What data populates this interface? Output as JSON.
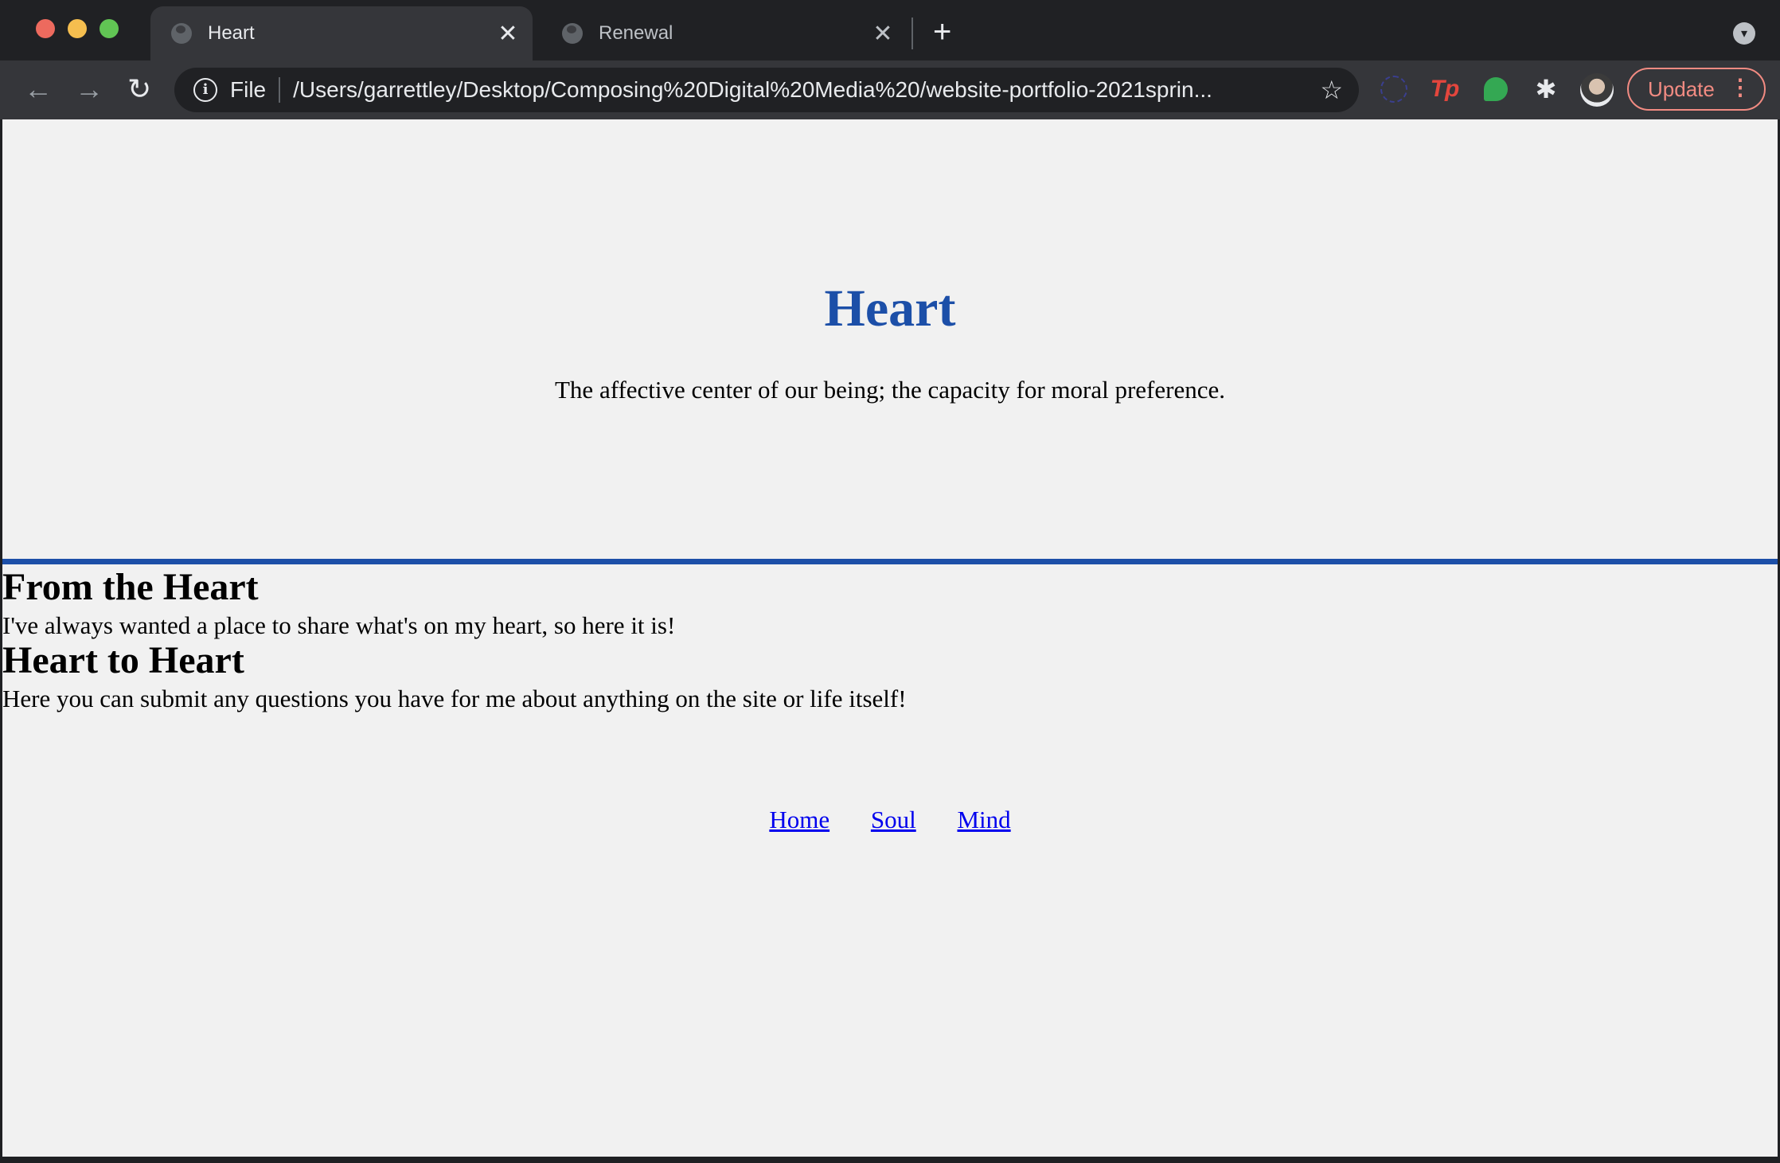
{
  "browser": {
    "tabs": [
      {
        "title": "Heart",
        "active": true
      },
      {
        "title": "Renewal",
        "active": false
      }
    ],
    "new_tab_symbol": "+",
    "close_symbol": "✕",
    "address": {
      "scheme_label": "File",
      "url": "/Users/garrettley/Desktop/Composing%20Digital%20Media%20/website-portfolio-2021sprin..."
    },
    "update_button": "Update",
    "icons": [
      "back-arrow-icon",
      "forward-arrow-icon",
      "reload-icon",
      "info-icon",
      "star-icon",
      "extension-circle-icon",
      "tp-extension-icon",
      "green-chat-extension-icon",
      "puzzle-icon",
      "avatar",
      "kebab-menu-icon"
    ],
    "colors": {
      "update_accent": "#f28b82",
      "chrome_bg": "#202124"
    }
  },
  "page": {
    "hero": {
      "title": "Heart",
      "subtitle": "The affective center of our being; the capacity for moral preference."
    },
    "sections": [
      {
        "heading": "From the Heart",
        "text": "I've always wanted a place to share what's on my heart, so here it is!"
      },
      {
        "heading": "Heart to Heart",
        "text": "Here you can submit any questions you have for me about anything on the site or life itself!"
      }
    ],
    "nav": [
      "Home",
      "Soul",
      "Mind"
    ],
    "colors": {
      "accent": "#1c4fa8",
      "background": "#f1f1f1",
      "link": "#0000ee"
    }
  }
}
